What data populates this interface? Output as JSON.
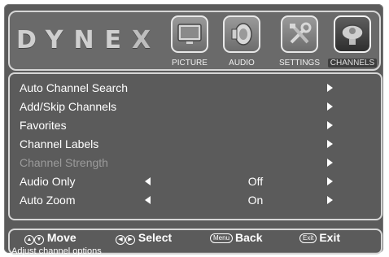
{
  "brand": {
    "logo_text": "DYNE",
    "logo_x": "X"
  },
  "menu_tabs": [
    {
      "label": "PICTURE",
      "icon": "tv-monitor-icon"
    },
    {
      "label": "AUDIO",
      "icon": "speaker-icon"
    },
    {
      "label": "SETTINGS",
      "icon": "tools-icon"
    },
    {
      "label": "CHANNELS",
      "icon": "satellite-dish-icon",
      "active": true
    }
  ],
  "items": [
    {
      "label": "Auto Channel Search",
      "value": ""
    },
    {
      "label": "Add/Skip Channels",
      "value": ""
    },
    {
      "label": "Favorites",
      "value": ""
    },
    {
      "label": "Channel Labels",
      "value": ""
    },
    {
      "label": "Channel Strength",
      "value": "",
      "disabled": true
    },
    {
      "label": "Audio Only",
      "value": "Off"
    },
    {
      "label": "Auto Zoom",
      "value": "On"
    }
  ],
  "footer": {
    "move_label": "Move",
    "select_label": "Select",
    "menu_key": "Menu",
    "back_label": "Back",
    "exit_key": "Exit",
    "exit_label": "Exit",
    "status_text": "Adjust channel options"
  },
  "colors": {
    "panel": "#5b5b5b",
    "border": "#d6d6d6",
    "text": "#ffffff",
    "dim_text": "#9b9b9b"
  }
}
